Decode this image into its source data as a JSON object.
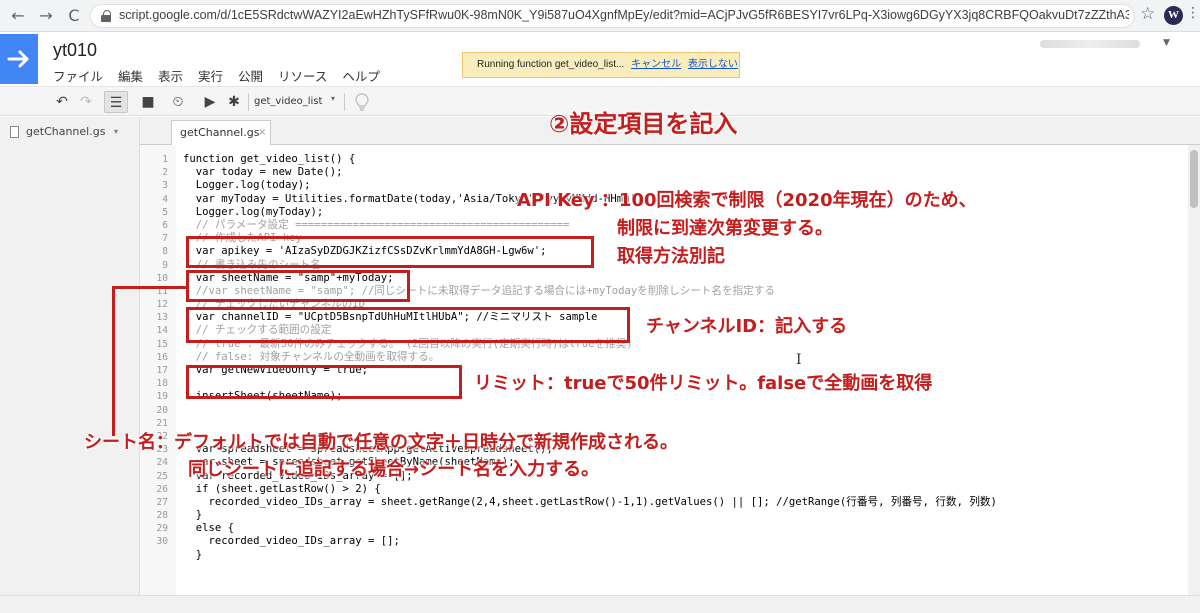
{
  "browser": {
    "url": "script.google.com/d/1cE5SRdctwWAZYI2aEwHZhTySFfRwu0K-98mN0K_Y9i587uO4XgnfMpEy/edit?mid=ACjPJvG5fR6BESYI7vr6LPq-X3iowg6DGyYX3jq8CRBFQOakvuDt7zZZthA39...",
    "back_icon": "←",
    "forward_icon": "→",
    "reload_icon": "C",
    "star_icon": "☆",
    "profile_icon": "W",
    "menu_icon": "⋮"
  },
  "app": {
    "title": "yt010",
    "menu": [
      "ファイル",
      "編集",
      "表示",
      "実行",
      "公開",
      "リソース",
      "ヘルプ"
    ],
    "status": {
      "text": "Running function get_video_list...",
      "cancel": "キャンセル",
      "hide": "表示しない"
    }
  },
  "toolbar": {
    "undo": "↶",
    "redo": "↷",
    "indent": "☰",
    "save": "■",
    "triggers": "⏲",
    "run": "▶",
    "debug": "✱",
    "function_select": "get_video_list",
    "caret": "▾"
  },
  "sidebar": {
    "file": "getChannel.gs",
    "caret": "▾"
  },
  "editor": {
    "tab_label": "getChannel.gs",
    "tab_close": "×",
    "line_numbers": [
      "1",
      "2",
      "3",
      "4",
      "5",
      "6",
      "7",
      "8",
      "9",
      "10",
      "11",
      "12",
      "13",
      "14",
      "15",
      "16",
      "17",
      "18",
      "19",
      "20",
      "21",
      "22",
      "23",
      "24",
      "25",
      "26",
      "27",
      "28",
      "29",
      "30"
    ],
    "lines": [
      "function get_video_list() {",
      "  var today = new Date();",
      "  Logger.log(today);",
      "  var myToday = Utilities.formatDate(today,'Asia/Tokyo','yyyyMMdd-HHmm');",
      "  Logger.log(myToday);",
      "  // パラメータ設定 ===========================================",
      "  // 作成したAPI key",
      "  var apikey = 'AIzaSyDZDGJKZizfCSsDZvKrlmmYdA8GH-Lgw6w';",
      "  // 書き込み先のシート名",
      "  var sheetName = \"samp\"+myToday;",
      "  //var sheetName = \"samp\"; //同じシートに未取得データ追記する場合には+myTodayを削除しシート名を指定する",
      "  // チェックしたいチャンネルのID",
      "  var channelID = \"UCptD5BsnpTdUhHuMItlHUbA\"; //ミニマリスト sample",
      "  // チェックする範囲の設定",
      "  // true : 最新50件のみチェックする。 (2回目以降の実行(定期実行時)はtrueを推奨)",
      "  // false: 対象チャンネルの全動画を取得する。",
      "  var getNewVideoOnly = true;",
      "",
      "  insertSheet(sheetName);",
      "",
      "",
      "",
      "  var spreadsheet = SpreadsheetApp.getActiveSpreadsheet();",
      "  var sheet = spreadsheet.getSheetByName(sheetName);",
      "  var recorded_video_IDs_array = [];",
      "  if (sheet.getLastRow() > 2) {",
      "    recorded_video_IDs_array = sheet.getRange(2,4,sheet.getLastRow()-1,1).getValues() || []; //getRange(行番号, 列番号, 行数, 列数)",
      "  }",
      "  else {",
      "    recorded_video_IDs_array = [];",
      "  }"
    ],
    "cursor_icon": "I"
  },
  "annotations": {
    "title": "②設定項目を記入",
    "apikey_note_line1": "API Key ：100回検索で制限（2020年現在）のため、",
    "apikey_note_line2": "制限に到達次第変更する。",
    "apikey_note_line3": "取得方法別記",
    "channel_note": "チャンネルID：記入する",
    "limit_note": "リミット：trueで50件リミット。falseで全動画を取得",
    "sheet_note_line1": "シート名：デフォルトでは自動で任意の文字＋日時分で新規作成される。",
    "sheet_note_line2": "同じシートに追記する場合→シート名を入力する。",
    "color": "#c41d1d"
  }
}
